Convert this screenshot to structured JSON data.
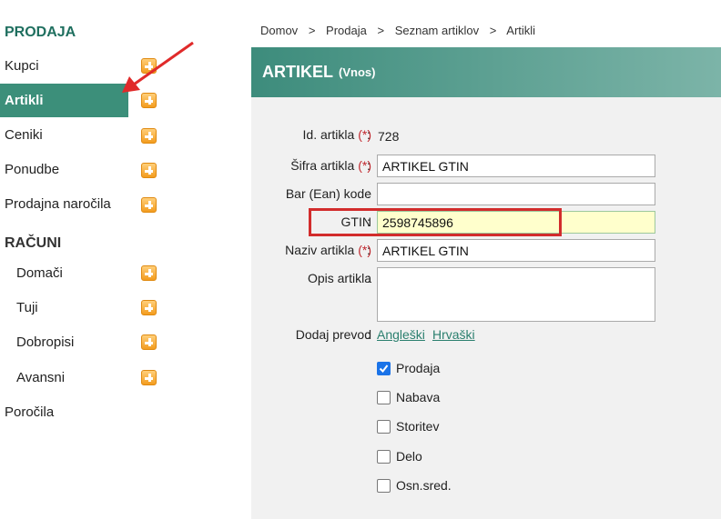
{
  "sidebar": {
    "sections": [
      {
        "title": "PRODAJA"
      },
      {
        "title": "RAČUNI"
      }
    ],
    "items": [
      {
        "label": "Kupci"
      },
      {
        "label": "Artikli"
      },
      {
        "label": "Ceniki"
      },
      {
        "label": "Ponudbe"
      },
      {
        "label": "Prodajna naročila"
      },
      {
        "label": "Domači"
      },
      {
        "label": "Tuji"
      },
      {
        "label": "Dobropisi"
      },
      {
        "label": "Avansni"
      },
      {
        "label": "Poročila"
      }
    ]
  },
  "breadcrumb": [
    "Domov",
    ">",
    "Prodaja",
    ">",
    "Seznam artiklov",
    ">",
    "Artikli"
  ],
  "header": {
    "title": "ARTIKEL",
    "subtitle": "(Vnos)"
  },
  "form": {
    "id_label": "Id. artikla",
    "id_value": "728",
    "sifra_label": "Šifra artikla",
    "sifra_value": "ARTIKEL GTIN",
    "barcode_label": "Bar (Ean) kode",
    "barcode_value": "",
    "gtin_label": "GTIN",
    "gtin_value": "2598745896",
    "naziv_label": "Naziv artikla",
    "naziv_value": "ARTIKEL GTIN",
    "opis_label": "Opis artikla",
    "opis_value": "",
    "required_mark": "(*)",
    "colon": ":",
    "translate_label": "Dodaj prevod",
    "translate_links": [
      "Angleški",
      "Hrvaški"
    ],
    "checkboxes": [
      {
        "label": "Prodaja",
        "checked": true
      },
      {
        "label": "Nabava",
        "checked": false
      },
      {
        "label": "Storitev",
        "checked": false
      },
      {
        "label": "Delo",
        "checked": false
      },
      {
        "label": "Osn.sred.",
        "checked": false
      }
    ]
  },
  "colors": {
    "accent": "#3c8f7a",
    "highlight": "#d22c2c",
    "gtin_bg": "#ffffcc"
  }
}
